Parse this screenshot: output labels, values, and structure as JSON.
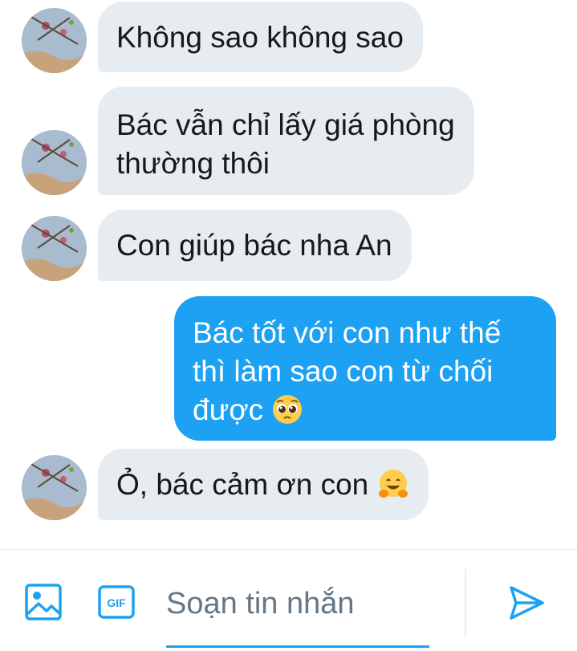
{
  "conversation": {
    "messages": [
      {
        "direction": "incoming",
        "lines": [
          "Không sao không sao"
        ]
      },
      {
        "direction": "incoming",
        "lines": [
          "Bác vẫn chỉ lấy giá phòng",
          "thường thôi"
        ]
      },
      {
        "direction": "incoming",
        "lines": [
          "Con giúp bác nha An"
        ]
      },
      {
        "direction": "outgoing",
        "lines": [
          "Bác tốt với con như thế",
          "thì làm sao con từ chối",
          "được"
        ],
        "emoji": "pleading-face-emoji"
      },
      {
        "direction": "incoming",
        "lines": [
          "Ỏ, bác cảm ơn con"
        ],
        "emoji": "hugging-face-emoji"
      }
    ]
  },
  "composer": {
    "placeholder": "Soạn tin nhắn",
    "gif_label": "GIF",
    "icons": [
      "image-icon",
      "gif-icon",
      "send-icon"
    ]
  },
  "colors": {
    "accent": "#1da1f2",
    "incoming_bubble": "#e6ecf0",
    "outgoing_text": "#ffffff",
    "text": "#16181c",
    "placeholder": "#657786"
  }
}
